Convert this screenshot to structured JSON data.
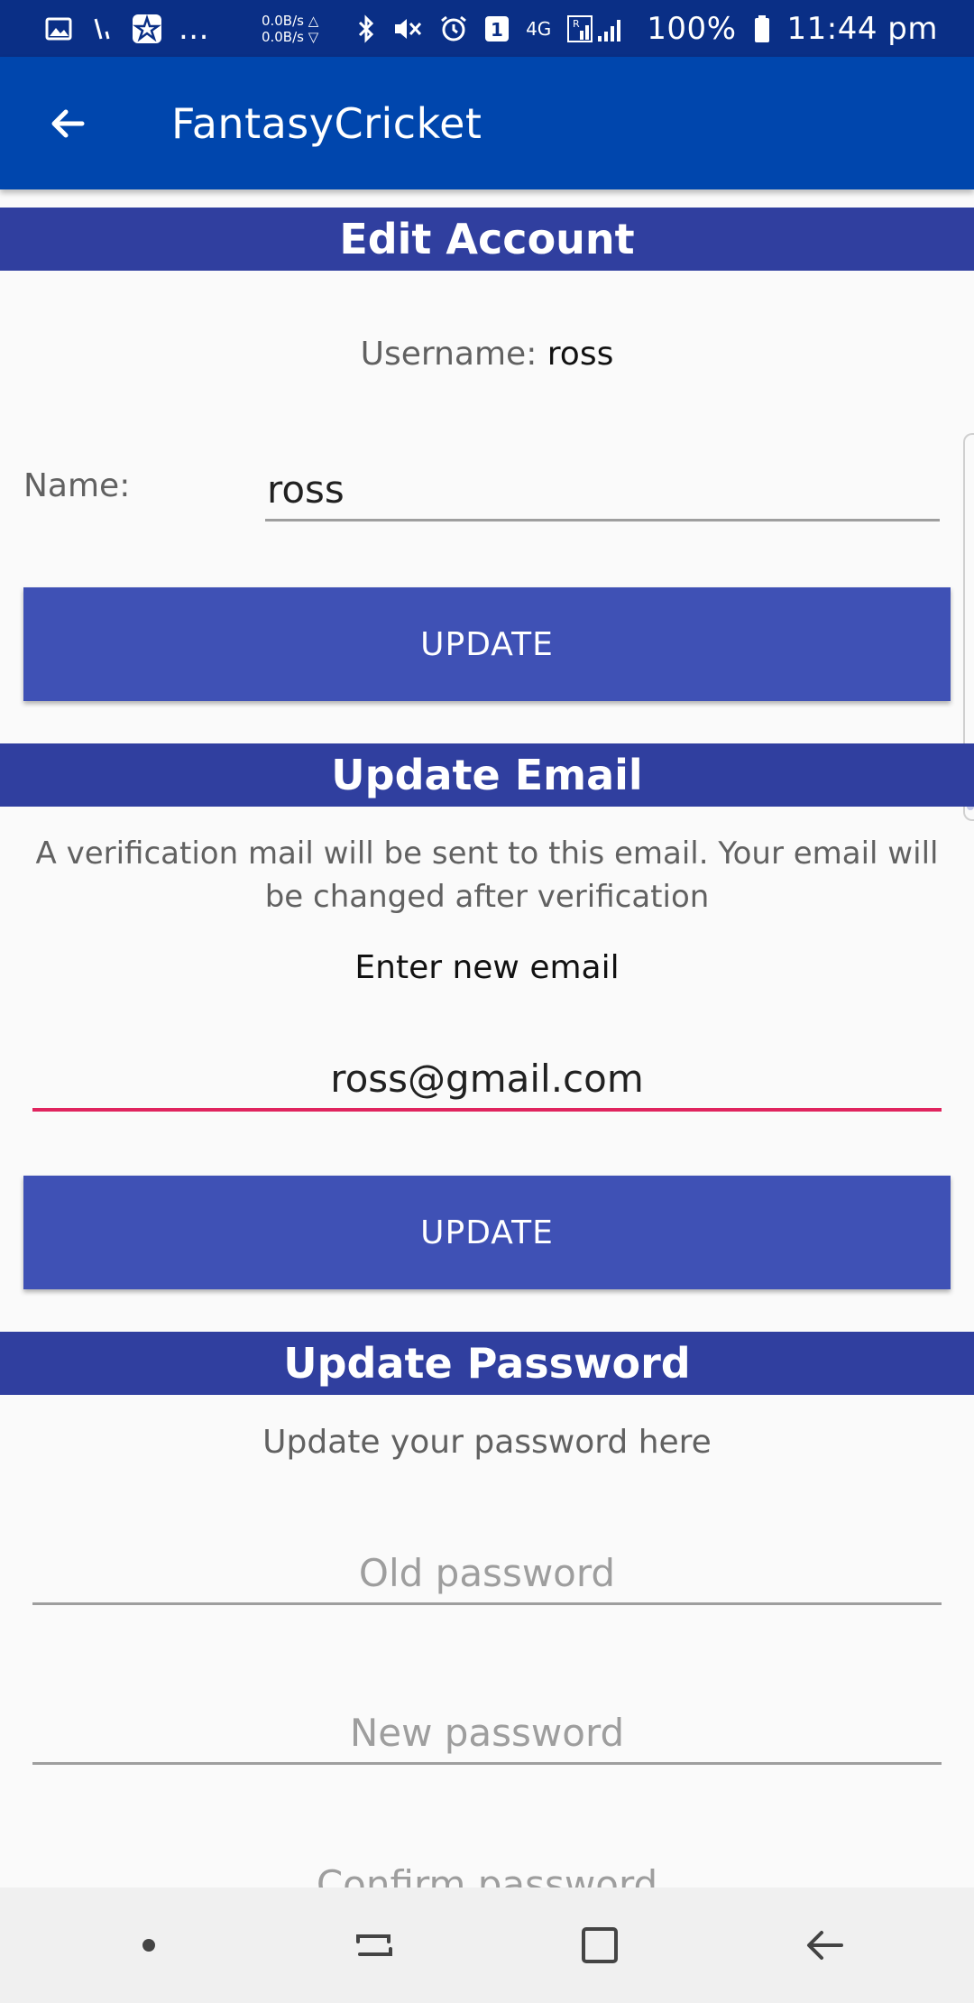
{
  "status_bar": {
    "net_up": "0.0B/s △",
    "net_down": "0.0B/s ▽",
    "notification_count": "1",
    "network_type": "4G",
    "battery": "100%",
    "time": "11:44 pm",
    "more": "..."
  },
  "app_bar": {
    "title": "FantasyCricket"
  },
  "edit_account": {
    "header": "Edit Account",
    "username_label": "Username:",
    "username_value": "ross",
    "name_label": "Name:",
    "name_value": "ross",
    "update_label": "UPDATE"
  },
  "update_email": {
    "header": "Update Email",
    "info_line1": "A verification mail will be sent to this email. Your email will",
    "info_line2": "be changed after verification",
    "prompt": "Enter new email",
    "email_value": "ross@gmail.com",
    "update_label": "UPDATE"
  },
  "update_password": {
    "header": "Update Password",
    "subtitle": "Update your password here",
    "old_placeholder": "Old password",
    "new_placeholder": "New password",
    "confirm_placeholder": "Confirm password"
  },
  "colors": {
    "status_bar": "#0a2f86",
    "app_bar": "#0046ad",
    "section_header": "#303f9f",
    "button": "#3f51b5",
    "focus_underline": "#e0245e"
  }
}
